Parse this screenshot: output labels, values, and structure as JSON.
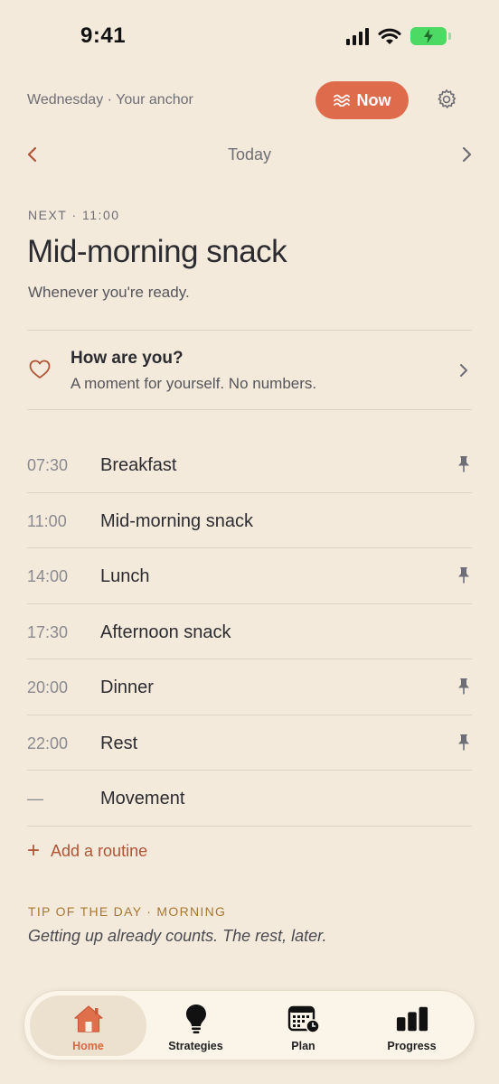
{
  "status_bar": {
    "time": "9:41"
  },
  "header": {
    "subtitle": "Wednesday · Your anchor",
    "now_label": "Now",
    "accent": "#de6b4b"
  },
  "date_nav": {
    "label": "Today"
  },
  "next": {
    "kicker": "NEXT · 11:00",
    "title": "Mid-morning snack",
    "subtitle": "Whenever you're ready."
  },
  "checkin": {
    "title": "How are you?",
    "subtitle": "A moment for yourself. No numbers."
  },
  "routines": [
    {
      "time": "07:30",
      "name": "Breakfast",
      "pinned": true
    },
    {
      "time": "11:00",
      "name": "Mid-morning snack",
      "pinned": false
    },
    {
      "time": "14:00",
      "name": "Lunch",
      "pinned": true
    },
    {
      "time": "17:30",
      "name": "Afternoon snack",
      "pinned": false
    },
    {
      "time": "20:00",
      "name": "Dinner",
      "pinned": true
    },
    {
      "time": "22:00",
      "name": "Rest",
      "pinned": true
    },
    {
      "time": "—",
      "name": "Movement",
      "pinned": false
    }
  ],
  "add_routine": {
    "label": "Add a routine"
  },
  "tip": {
    "kicker": "TIP OF THE DAY · MORNING",
    "text": "Getting up already counts. The rest, later."
  },
  "tabs": [
    {
      "label": "Home",
      "icon": "home-icon",
      "active": true
    },
    {
      "label": "Strategies",
      "icon": "lightbulb-icon",
      "active": false
    },
    {
      "label": "Plan",
      "icon": "calendar-clock-icon",
      "active": false
    },
    {
      "label": "Progress",
      "icon": "bar-chart-icon",
      "active": false
    }
  ],
  "colors": {
    "background": "#f3eadc",
    "accent": "#de6b4b",
    "tip_accent": "#a9782e",
    "battery": "#4cd964"
  }
}
